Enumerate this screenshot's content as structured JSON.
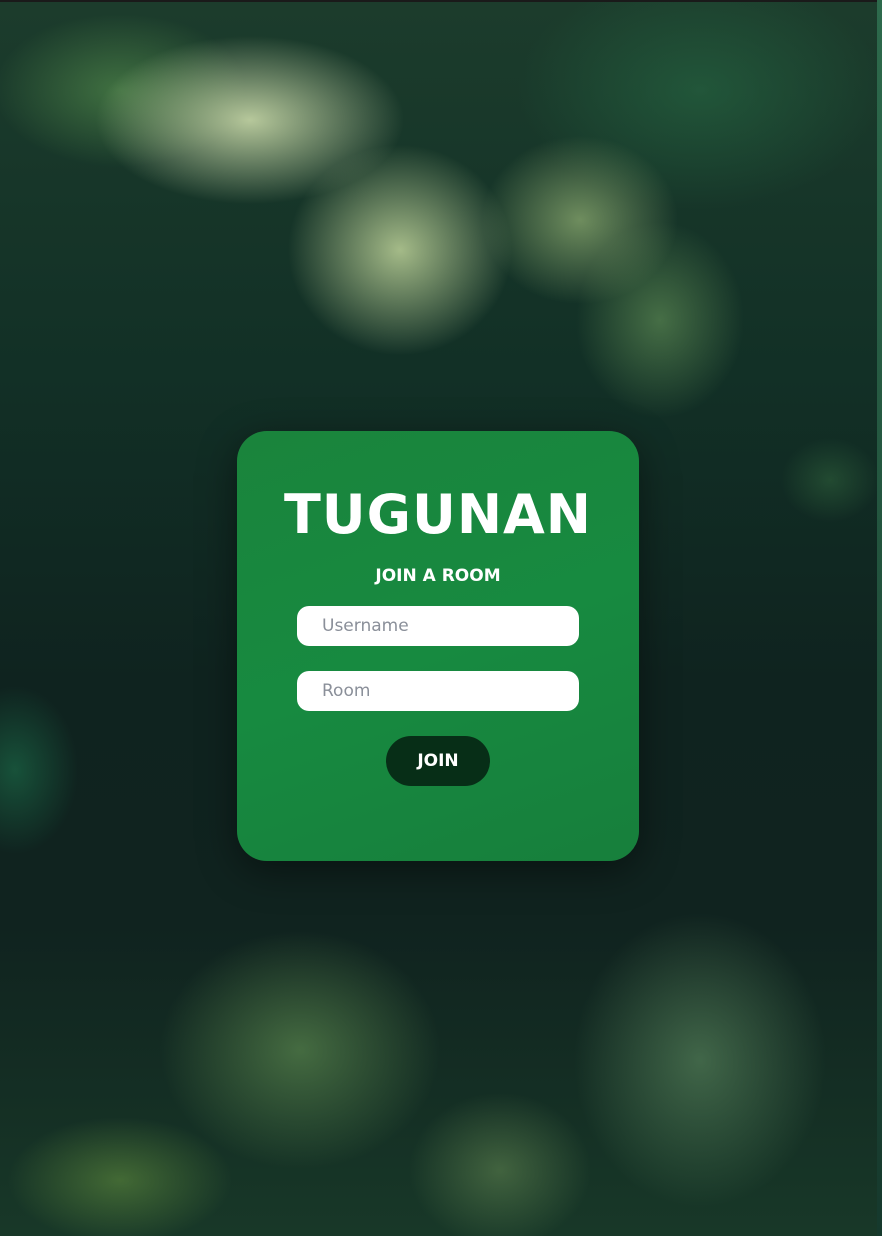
{
  "app": {
    "title": "TUGUNAN",
    "subtitle": "JOIN A ROOM"
  },
  "form": {
    "username": {
      "placeholder": "Username",
      "value": ""
    },
    "room": {
      "placeholder": "Room",
      "value": ""
    },
    "join_label": "JOIN"
  },
  "colors": {
    "card": "#178A40",
    "button": "#072E17",
    "input_background": "#FFFFFF",
    "text": "#FFFFFF"
  }
}
